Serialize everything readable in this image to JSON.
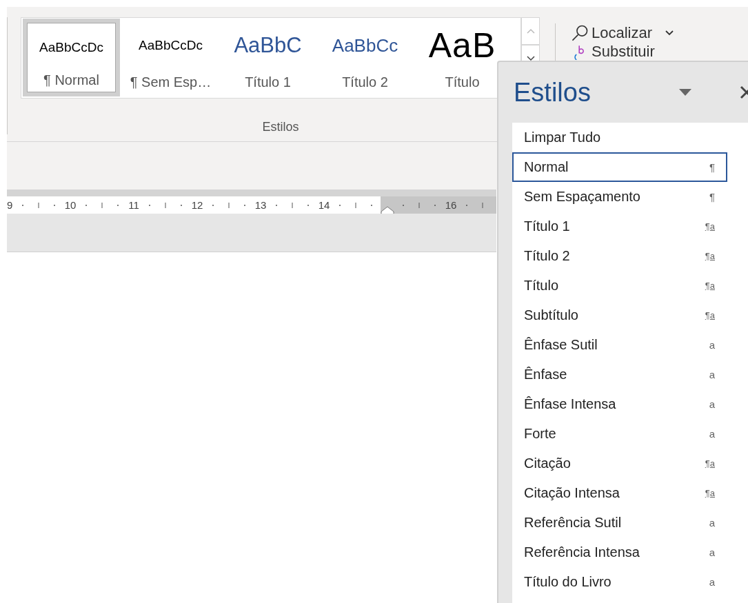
{
  "gallery": {
    "items": [
      {
        "preview": "AaBbCcDc",
        "label": "¶ Normal",
        "kind": "body",
        "selected": true
      },
      {
        "preview": "AaBbCcDc",
        "label": "¶ Sem Esp…",
        "kind": "body",
        "selected": false
      },
      {
        "preview": "AaBbC",
        "label": "Título 1",
        "kind": "heading1",
        "selected": false
      },
      {
        "preview": "AaBbCc",
        "label": "Título 2",
        "kind": "heading2",
        "selected": false
      },
      {
        "preview": "AaB",
        "label": "Título",
        "kind": "title",
        "selected": false
      }
    ],
    "group_label": "Estilos"
  },
  "editing": {
    "find": "Localizar",
    "replace": "Substituir"
  },
  "ruler": {
    "numbers": [
      {
        "label": "9",
        "margin": false
      },
      {
        "label": "10",
        "margin": false
      },
      {
        "label": "11",
        "margin": false
      },
      {
        "label": "12",
        "margin": false
      },
      {
        "label": "13",
        "margin": false
      },
      {
        "label": "14",
        "margin": false
      },
      {
        "label": "16",
        "margin": true
      }
    ]
  },
  "pane": {
    "title": "Estilos",
    "items": [
      {
        "name": "Limpar Tudo",
        "kind": "clear",
        "selected": false
      },
      {
        "name": "Normal",
        "kind": "paragraph",
        "symbol": "¶",
        "selected": true
      },
      {
        "name": "Sem Espaçamento",
        "kind": "paragraph",
        "symbol": "¶",
        "selected": false
      },
      {
        "name": "Título 1",
        "kind": "linked",
        "symbol": "¶a",
        "selected": false
      },
      {
        "name": "Título 2",
        "kind": "linked",
        "symbol": "¶a",
        "selected": false
      },
      {
        "name": "Título",
        "kind": "linked",
        "symbol": "¶a",
        "selected": false
      },
      {
        "name": "Subtítulo",
        "kind": "linked",
        "symbol": "¶a",
        "selected": false
      },
      {
        "name": "Ênfase Sutil",
        "kind": "character",
        "symbol": "a",
        "selected": false
      },
      {
        "name": "Ênfase",
        "kind": "character",
        "symbol": "a",
        "selected": false
      },
      {
        "name": "Ênfase Intensa",
        "kind": "character",
        "symbol": "a",
        "selected": false
      },
      {
        "name": "Forte",
        "kind": "character",
        "symbol": "a",
        "selected": false
      },
      {
        "name": "Citação",
        "kind": "linked",
        "symbol": "¶a",
        "selected": false
      },
      {
        "name": "Citação Intensa",
        "kind": "linked",
        "symbol": "¶a",
        "selected": false
      },
      {
        "name": "Referência Sutil",
        "kind": "character",
        "symbol": "a",
        "selected": false
      },
      {
        "name": "Referência Intensa",
        "kind": "character",
        "symbol": "a",
        "selected": false
      },
      {
        "name": "Título do Livro",
        "kind": "character",
        "symbol": "a",
        "selected": false
      }
    ]
  }
}
